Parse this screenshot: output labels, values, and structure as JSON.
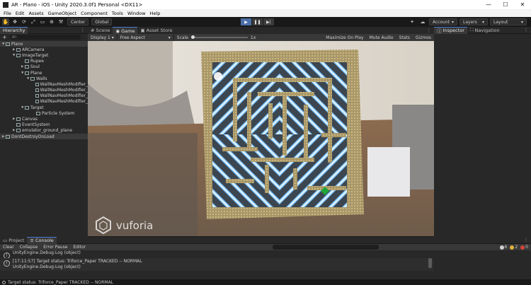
{
  "window": {
    "title": "AR - Plano - iOS - Unity 2020.3.0f1 Personal <DX11>",
    "minimize": "—",
    "maximize": "☐",
    "close": "✕"
  },
  "menu": [
    "File",
    "Edit",
    "Assets",
    "GameObject",
    "Component",
    "Tools",
    "Window",
    "Help"
  ],
  "toolbar": {
    "pivot_center": "Center",
    "pivot_global": "Global",
    "account": "Account",
    "layers": "Layers",
    "layout": "Layout"
  },
  "hierarchy": {
    "tab": "Hierarchy",
    "search_placeholder": "All",
    "rows": [
      {
        "label": "Plano"
      },
      {
        "label": "ARCamera"
      },
      {
        "label": "ImageTarget"
      },
      {
        "label": "Rupee"
      },
      {
        "label": "Soul"
      },
      {
        "label": "Plane"
      },
      {
        "label": "Walls"
      },
      {
        "label": "WallNavMeshModifier_"
      },
      {
        "label": "WallNavMeshModifier_"
      },
      {
        "label": "WallNavMeshModifier_"
      },
      {
        "label": "WallNavMeshModifier_"
      },
      {
        "label": "Target"
      },
      {
        "label": "Particle System"
      },
      {
        "label": "Canvas"
      },
      {
        "label": "EventSystem"
      },
      {
        "label": "emulator_ground_plane"
      },
      {
        "label": "DontDestroyOnLoad"
      }
    ]
  },
  "center": {
    "tabs": [
      "Scene",
      "Game",
      "Asset Store"
    ],
    "display": "Display 1",
    "aspect": "Free Aspect",
    "scale_label": "Scale",
    "scale_value": "1x",
    "right_buttons": [
      "Maximize On Play",
      "Mute Audio",
      "Stats",
      "Gizmos"
    ],
    "watermark": "vuforia"
  },
  "inspector": {
    "tabs": [
      "Inspector",
      "Navigation"
    ]
  },
  "console": {
    "tabs": [
      "Project",
      "Console"
    ],
    "buttons": [
      "Clear",
      "Collapse",
      "Error Pause",
      "Editor"
    ],
    "counts": {
      "info": "6",
      "warn": "2",
      "error": "0"
    },
    "logs": [
      {
        "line1": "",
        "line2": "UnityEngine.Debug:Log (object)"
      },
      {
        "line1": "[17:11:57] Target status: Triforce_Paper TRACKED -- NORMAL",
        "line2": "UnityEngine.Debug:Log (object)"
      }
    ]
  },
  "status": {
    "text": "Target status: Triforce_Paper TRACKED -- NORMAL"
  },
  "colors": {
    "accent": "#4a7bd0",
    "selection": "#2c5d87",
    "maze_glow": "#5fa9ff",
    "maze_wall": "#b8a26d",
    "green_gem": "#1fa53a"
  }
}
